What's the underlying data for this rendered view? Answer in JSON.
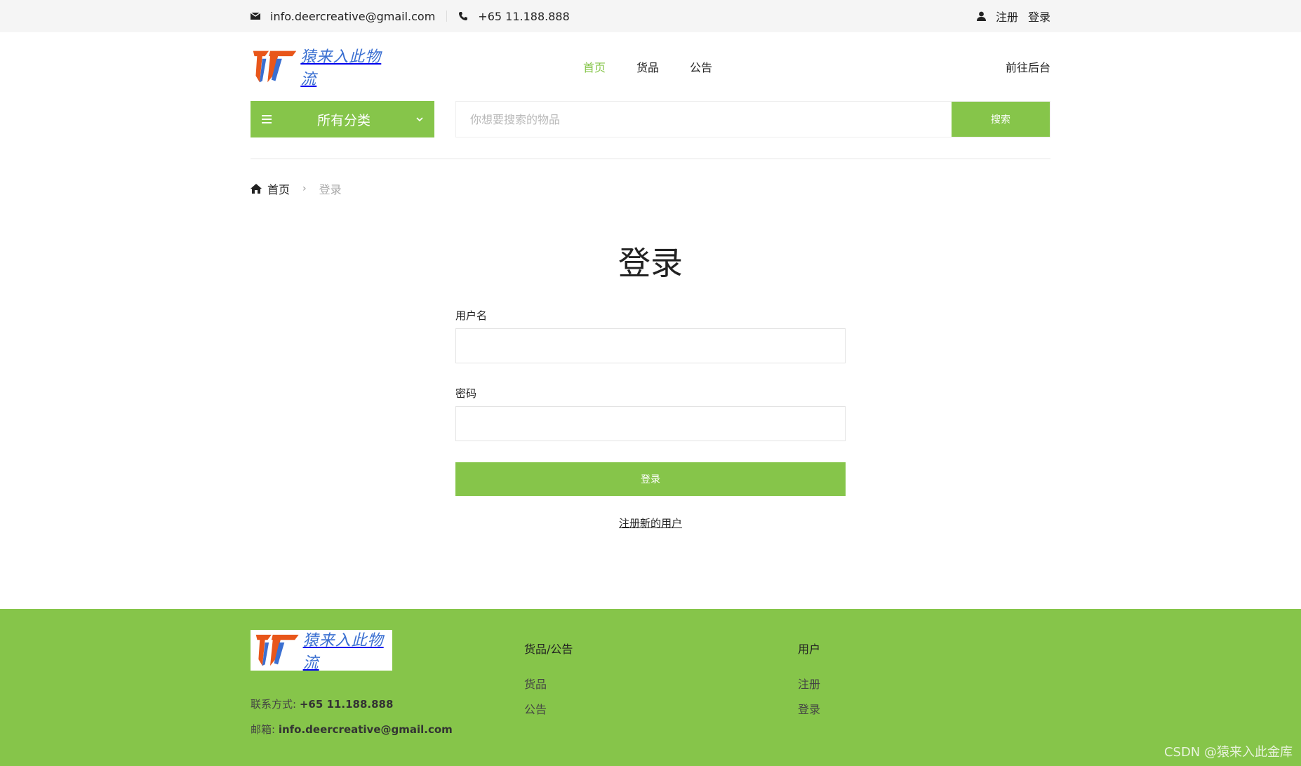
{
  "topbar": {
    "email": "info.deercreative@gmail.com",
    "phone": "+65 11.188.888",
    "register": "注册",
    "login": "登录"
  },
  "header": {
    "logo_text": "猿来入此物流",
    "nav": [
      {
        "label": "首页",
        "active": true
      },
      {
        "label": "货品",
        "active": false
      },
      {
        "label": "公告",
        "active": false
      }
    ],
    "admin_link": "前往后台"
  },
  "search": {
    "category_label": "所有分类",
    "placeholder": "你想要搜索的物品",
    "button": "搜索"
  },
  "breadcrumb": {
    "home": "首页",
    "current": "登录"
  },
  "login": {
    "title": "登录",
    "username_label": "用户名",
    "username_value": "",
    "password_label": "密码",
    "password_value": "",
    "submit": "登录",
    "register_link": "注册新的用户"
  },
  "footer": {
    "logo_text": "猿来入此物流",
    "contact_label": "联系方式: ",
    "contact_value": "+65 11.188.888",
    "email_label": "邮箱: ",
    "email_value": "info.deercreative@gmail.com",
    "col1_title": "货品/公告",
    "col1_links": [
      "货品",
      "公告"
    ],
    "col2_title": "用户",
    "col2_links": [
      "注册",
      "登录"
    ]
  },
  "watermark": "CSDN @猿来入此金库",
  "colors": {
    "accent": "#86c54a",
    "topbar_bg": "#f5f5f5",
    "logo_orange": "#e8561a",
    "logo_blue": "#3a6fd1"
  }
}
